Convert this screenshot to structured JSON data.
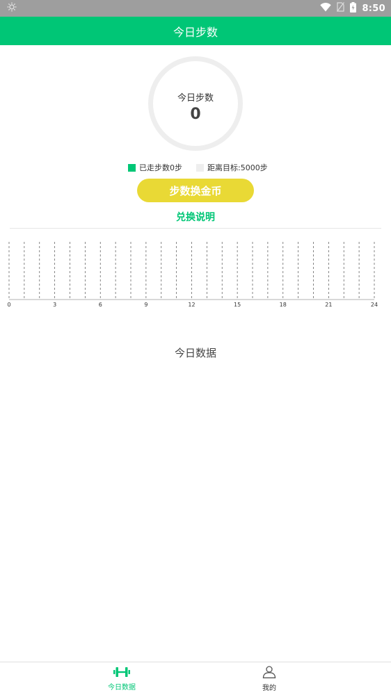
{
  "status_bar": {
    "time": "8:50"
  },
  "app_bar": {
    "title": "今日步数"
  },
  "steps": {
    "ring_label": "今日步数",
    "count": "0"
  },
  "legend": {
    "walked": "已走步数0步",
    "remaining": "距离目标:5000步"
  },
  "actions": {
    "exchange_button": "步数换金币",
    "exchange_info": "兑换说明"
  },
  "chart_data": {
    "type": "bar",
    "x": [
      0,
      1,
      2,
      3,
      4,
      5,
      6,
      7,
      8,
      9,
      10,
      11,
      12,
      13,
      14,
      15,
      16,
      17,
      18,
      19,
      20,
      21,
      22,
      23,
      24
    ],
    "x_ticks": [
      "0",
      "3",
      "6",
      "9",
      "12",
      "15",
      "18",
      "21",
      "24"
    ],
    "x_range": [
      0,
      24
    ],
    "values": [],
    "grid": "dashed vertical"
  },
  "section": {
    "title": "今日数据"
  },
  "bottom_nav": {
    "tabs": [
      {
        "label": "今日数据",
        "icon": "dumbbell-icon",
        "active": true
      },
      {
        "label": "我的",
        "icon": "user-icon",
        "active": false
      }
    ]
  },
  "colors": {
    "primary": "#00c676",
    "button": "#e9d935",
    "ring": "#eeeeee"
  }
}
